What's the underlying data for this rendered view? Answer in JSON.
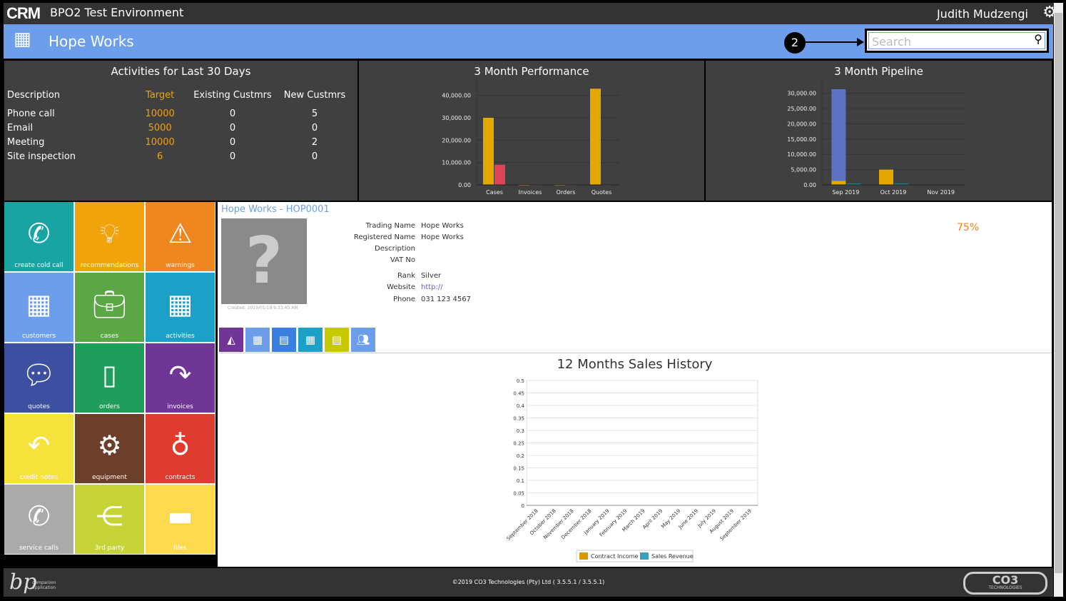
{
  "topbar": {
    "logo": "CRM",
    "environment": "BPO2 Test Environment",
    "user": "Judith Mudzengi",
    "gear_icon": "gear-icon"
  },
  "header": {
    "icon": "building-icon",
    "title": "Hope Works",
    "search_placeholder": "Search",
    "callout": "2"
  },
  "activities": {
    "title": "Activities for Last 30 Days",
    "headers": [
      "Description",
      "Target",
      "Existing Custmrs",
      "New Custmrs"
    ],
    "rows": [
      [
        "Phone call",
        "10000",
        "0",
        "5"
      ],
      [
        "Email",
        "5000",
        "0",
        "0"
      ],
      [
        "Meeting",
        "10000",
        "0",
        "2"
      ],
      [
        "Site inspection",
        "6",
        "0",
        "0"
      ]
    ]
  },
  "tiles": [
    {
      "label": "create cold call",
      "icon": "phone-icon",
      "color": "#1aa3a3"
    },
    {
      "label": "recommendations",
      "icon": "lightbulb-icon",
      "color": "#f0a30a"
    },
    {
      "label": "warnings",
      "icon": "warning-icon",
      "color": "#f0861f"
    },
    {
      "label": "customers",
      "icon": "building-icon",
      "color": "#6d9eeb"
    },
    {
      "label": "cases",
      "icon": "briefcase-icon",
      "color": "#5aa744"
    },
    {
      "label": "activities",
      "icon": "calendar-icon",
      "color": "#1ba1c7"
    },
    {
      "label": "quotes",
      "icon": "chat-icon",
      "color": "#3d4fa0"
    },
    {
      "label": "orders",
      "icon": "book-icon",
      "color": "#1e9e5a"
    },
    {
      "label": "invoices",
      "icon": "redo-arrow-icon",
      "color": "#6f3597"
    },
    {
      "label": "credit notes",
      "icon": "undo-arrow-icon",
      "color": "#f5e23a"
    },
    {
      "label": "equipment",
      "icon": "gears-icon",
      "color": "#6b3f2a"
    },
    {
      "label": "contracts",
      "icon": "award-icon",
      "color": "#e03b2f"
    },
    {
      "label": "service calls",
      "icon": "phone-icon",
      "color": "#aaaaaa"
    },
    {
      "label": "3rd party",
      "icon": "share-icon",
      "color": "#c6d337"
    },
    {
      "label": "files",
      "icon": "folder-icon",
      "color": "#fdd94d"
    }
  ],
  "customer": {
    "title": "Hope Works - HOP0001",
    "created": "Created: 2019/01/18 9:33:45 AM",
    "completion": "75%",
    "fields": [
      {
        "label": "Trading Name",
        "value": "Hope Works"
      },
      {
        "label": "Registered Name",
        "value": "Hope Works"
      },
      {
        "label": "Description",
        "value": ""
      },
      {
        "label": "VAT No",
        "value": ""
      },
      {
        "label": "Rank",
        "value": "Silver"
      },
      {
        "label": "Website",
        "value": "http://"
      },
      {
        "label": "Phone",
        "value": "031 123 4567"
      }
    ],
    "tabs": [
      {
        "icon": "area-chart-icon",
        "color": "#6f3597"
      },
      {
        "icon": "building-icon",
        "color": "#6d9eeb"
      },
      {
        "icon": "contacts-book-icon",
        "color": "#3b7fe0"
      },
      {
        "icon": "calendar-icon",
        "color": "#1ba1c7"
      },
      {
        "icon": "document-icon",
        "color": "#c6c800"
      },
      {
        "icon": "users-icon",
        "color": "#6d9eeb"
      }
    ]
  },
  "footer": {
    "copyright": "©2019 CO3 Technologies (Pty) Ltd ( 3.5.5.1 / 3.5.5.1)",
    "bp_logo": "bp companion application",
    "co3_logo": "CO3 TECHNOLOGIES"
  },
  "chart_data": [
    {
      "type": "bar",
      "title": "3 Month Performance",
      "categories": [
        "Cases",
        "Invoices",
        "Orders",
        "Quotes"
      ],
      "ylim": [
        0,
        45000
      ],
      "yticks": [
        "0.00",
        "10,000.00",
        "20,000.00",
        "30,000.00",
        "40,000.00"
      ],
      "series": [
        {
          "values": [
            30000,
            0,
            0,
            43000
          ],
          "color": "#e5a800"
        },
        {
          "values": [
            9000,
            100,
            100,
            100
          ],
          "color": "#e0445a"
        }
      ]
    },
    {
      "type": "bar",
      "title": "3 Month Pipeline",
      "categories": [
        "Sep 2019",
        "Oct 2019",
        "Nov 2019"
      ],
      "ylim": [
        0,
        32000
      ],
      "yticks": [
        "0.00",
        "5,000.00",
        "10,000.00",
        "15,000.00",
        "20,000.00",
        "25,000.00",
        "30,000.00"
      ],
      "stacked_series": [
        {
          "values": [
            1300,
            5000,
            0
          ],
          "color": "#e5a800"
        },
        {
          "values": [
            30000,
            0,
            0
          ],
          "color": "#5b73c4"
        }
      ],
      "side_series": [
        {
          "values": [
            200,
            200,
            0
          ],
          "color": "#1a8a8a"
        }
      ]
    },
    {
      "type": "line",
      "title": "12 Months Sales History",
      "categories": [
        "September 2018",
        "October 2018",
        "November 2018",
        "December 2018",
        "January 2019",
        "February 2019",
        "March 2019",
        "April 2019",
        "May 2019",
        "June 2019",
        "July 2019",
        "August 2019",
        "September 2019"
      ],
      "ylim": [
        0,
        0.5
      ],
      "yticks": [
        "0",
        "0.05",
        "0.1",
        "0.15",
        "0.2",
        "0.25",
        "0.3",
        "0.35",
        "0.4",
        "0.45",
        "0.5"
      ],
      "grid": true,
      "legend": "bottom",
      "series": [
        {
          "name": "Contract Income",
          "color": "#d49a00",
          "values": []
        },
        {
          "name": "Sales Revenue",
          "color": "#3aa0b8",
          "values": []
        }
      ]
    }
  ]
}
